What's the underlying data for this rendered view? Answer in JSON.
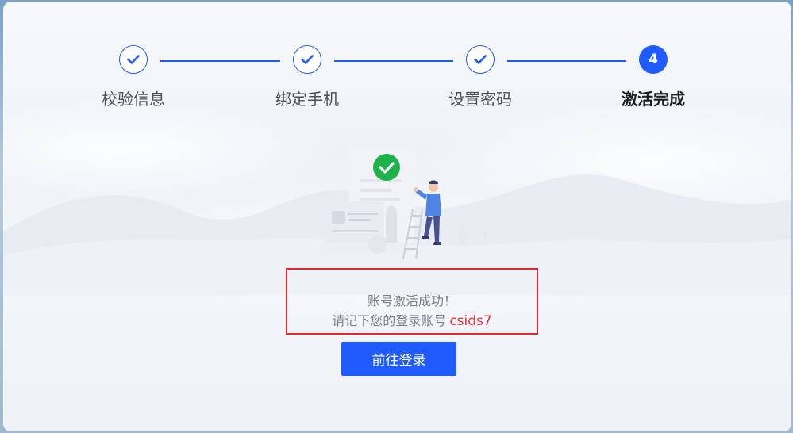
{
  "stepper": {
    "steps": [
      {
        "label": "校验信息",
        "status": "done"
      },
      {
        "label": "绑定手机",
        "status": "done"
      },
      {
        "label": "设置密码",
        "status": "done"
      },
      {
        "label": "激活完成",
        "status": "active",
        "number": "4"
      }
    ]
  },
  "message": {
    "line1": "账号激活成功！",
    "line2_prefix": "请记下您的登录账号",
    "account": "csids7"
  },
  "actions": {
    "login_label": "前往登录"
  },
  "colors": {
    "accent": "#1f5bff",
    "success": "#1fb24a",
    "highlight": "#e5262b"
  },
  "icons": {
    "step_done": "check-icon",
    "illustration_badge": "check-circle-icon"
  }
}
